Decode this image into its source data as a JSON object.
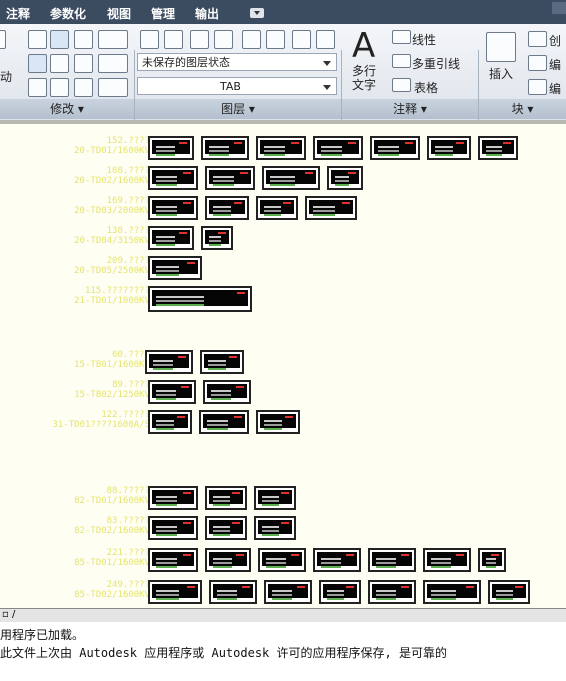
{
  "menu": {
    "items": [
      "注释",
      "参数化",
      "视图",
      "管理",
      "输出"
    ]
  },
  "ribbon": {
    "modify_panel": {
      "title": "修改",
      "partial_label": "动"
    },
    "layer_panel": {
      "title": "图层",
      "layer_state": "未保存的图层状态",
      "current_layer": "TAB"
    },
    "annotation_panel": {
      "title": "注释",
      "text_label": "多行\n文字",
      "linear_label": "线性",
      "multileader_label": "多重引线",
      "table_label": "表格"
    },
    "block_panel": {
      "title": "块",
      "insert_label": "插入",
      "create_label": "创",
      "edit_label": "编",
      "edit_attr_label": "编"
    }
  },
  "drawing": {
    "rows": [
      {
        "label1": "152.????",
        "label2": "20-TD01/1600KV",
        "cells": 7
      },
      {
        "label1": "168.????",
        "label2": "20-TD02/1600KV",
        "cells": 4
      },
      {
        "label1": "169.????",
        "label2": "20-TD03/2000KV",
        "cells": 4
      },
      {
        "label1": "138.????",
        "label2": "20-TD04/3150KV",
        "cells": 2
      },
      {
        "label1": "209.????",
        "label2": "20-TD05/2500KV",
        "cells": 1
      },
      {
        "label1": "115.????????",
        "label2": "21-TD01/1000KV",
        "cells": 1
      },
      {
        "label1": "60.????",
        "label2": "15-TB01/1600KV",
        "cells": 2
      },
      {
        "label1": "89.????",
        "label2": "15-TB02/1250KV",
        "cells": 2
      },
      {
        "label1": "122.?????",
        "label2": "31-TD01????1600A/S",
        "cells": 3
      },
      {
        "label1": "88.?????",
        "label2": "82-TD01/1600KV",
        "cells": 3
      },
      {
        "label1": "83.?????",
        "label2": "82-TD02/1600KV",
        "cells": 3
      },
      {
        "label1": "221.????",
        "label2": "85-TD01/1600KV",
        "cells": 7
      },
      {
        "label1": "249.????",
        "label2": "85-TD02/1600KV",
        "cells": 7
      }
    ]
  },
  "command": {
    "line1": "用程序已加载。",
    "line2": "  此文件上次由 Autodesk 应用程序或 Autodesk 许可的应用程序保存, 是可靠的"
  }
}
